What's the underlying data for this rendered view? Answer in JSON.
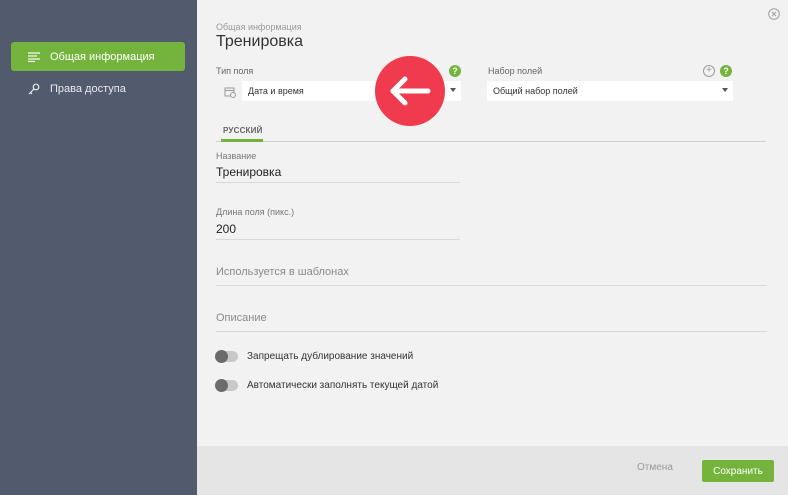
{
  "sidebar": {
    "items": [
      {
        "label": "Общая информация",
        "icon": "list-icon",
        "active": true
      },
      {
        "label": "Права доступа",
        "icon": "key-icon",
        "active": false
      }
    ]
  },
  "header": {
    "subtitle": "Общая информация",
    "title": "Тренировка"
  },
  "field_type": {
    "label": "Тип поля",
    "value": "Дата и время"
  },
  "field_set": {
    "label": "Набор полей",
    "value": "Общий набор полей"
  },
  "tabs": [
    {
      "label": "РУССКИЙ",
      "active": true
    }
  ],
  "form": {
    "name_label": "Название",
    "name_value": "Тренировка",
    "length_label": "Длина поля (пикс.)",
    "length_value": "200",
    "templates_placeholder": "Используется в шаблонах",
    "description_placeholder": "Описание"
  },
  "toggles": [
    {
      "label": "Запрещать дублирование значений",
      "on": false
    },
    {
      "label": "Автоматически заполнять текущей датой",
      "on": false
    }
  ],
  "footer": {
    "cancel_label": "Отмена",
    "save_label": "Сохранить"
  },
  "colors": {
    "accent": "#74b43c",
    "sidebar": "#525a6e",
    "arrow_badge": "#ef3b4d"
  }
}
